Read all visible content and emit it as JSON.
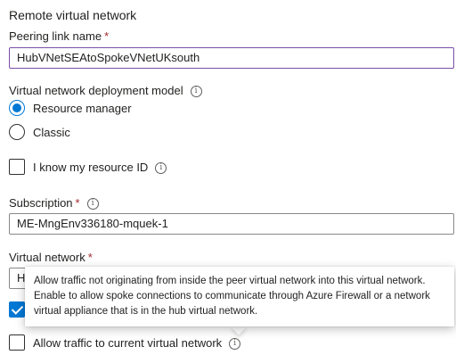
{
  "section_title": "Remote virtual network",
  "peering_link": {
    "label": "Peering link name",
    "required_mark": "*",
    "value": "HubVNetSEAtoSpokeVNetUKsouth"
  },
  "deployment_model": {
    "label": "Virtual network deployment model",
    "info_icon": "info-icon",
    "options": [
      {
        "label": "Resource manager",
        "checked": true
      },
      {
        "label": "Classic",
        "checked": false
      }
    ]
  },
  "resource_id": {
    "label": "I know my resource ID",
    "checked": false
  },
  "subscription": {
    "label": "Subscription",
    "required_mark": "*",
    "value": "ME-MngEnv336180-mquek-1"
  },
  "virtual_network": {
    "label": "Virtual network",
    "required_mark": "*",
    "value_partial": "H"
  },
  "allow_access_checkbox": {
    "checked": true
  },
  "tooltip": {
    "text": "Allow traffic not originating from inside the peer virtual network into this virtual network. Enable to allow spoke connections to communicate through Azure Firewall or a network virtual appliance that is in the hub virtual network."
  },
  "allow_traffic": {
    "label": "Allow traffic to current virtual network",
    "checked": false
  },
  "colors": {
    "accent": "#0078d4",
    "required": "#a4262c",
    "focus_border": "#7a4ea8"
  }
}
